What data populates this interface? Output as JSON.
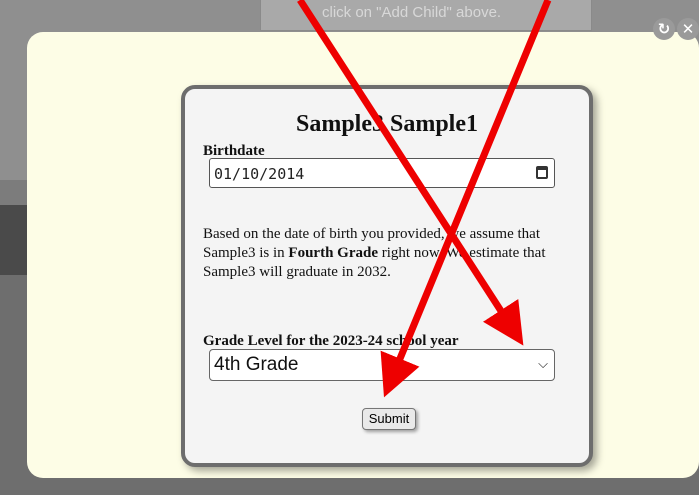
{
  "background": {
    "hint_text": "click on \"Add Child\" above."
  },
  "window": {
    "refresh_icon": "refresh-icon",
    "close_icon": "close-icon"
  },
  "form": {
    "student_name": "Sample3 Sample1",
    "birthdate_label": "Birthdate",
    "birthdate_value": "01/10/2014",
    "message": {
      "p1": "Based on the date of birth you provided, we assume that Sample3 is in ",
      "grade_bold": "Fourth Grade",
      "p2": " right now. We estimate that Sample3 will graduate in 2032."
    },
    "grade_label": "Grade Level for the 2023-24 school year",
    "grade_selected": "4th Grade",
    "submit_label": "Submit"
  },
  "colors": {
    "dialog_bg": "#fdfde6",
    "card_bg": "#f4f4f4",
    "annotation_red": "#ee0000"
  }
}
